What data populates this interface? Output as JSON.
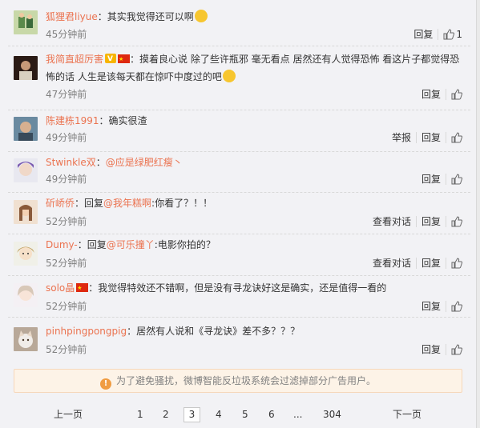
{
  "comments": [
    {
      "name": "狐狸君liyue",
      "text": "：其实我觉得还可以啊",
      "time": "45分钟前",
      "actions": [
        "回复"
      ],
      "likes": "1",
      "emoji": "laugh-cry"
    },
    {
      "name": "我简直超厉害",
      "text": "：摸着良心说 除了些许瓶邪 毫无看点 居然还有人觉得恐怖 看这片子都觉得恐",
      "text2": "怖的话 人生是该每天都在惊吓中度过的吧",
      "time": "47分钟前",
      "actions": [
        "回复"
      ],
      "emoji": "thinking"
    },
    {
      "name": "陈建栋1991",
      "text": "：确实很渣",
      "time": "49分钟前",
      "actions": [
        "举报",
        "回复"
      ]
    },
    {
      "name": "Stwinkle双",
      "text_pre": "：",
      "mention": "@应是绿肥红瘦丶",
      "text": "",
      "time": "49分钟前",
      "actions": [
        "回复"
      ]
    },
    {
      "name": "斫峤侨",
      "text_pre": "：回复",
      "mention": "@我年糕啊",
      "text": ":你看了？！！",
      "time": "52分钟前",
      "actions": [
        "查看对话",
        "回复"
      ]
    },
    {
      "name": "Dumy-",
      "text_pre": "：回复",
      "mention": "@可乐撞丫",
      "text": ":电影你拍的？",
      "time": "52分钟前",
      "actions": [
        "查看对话",
        "回复"
      ]
    },
    {
      "name": "solo晶",
      "text": "：我觉得特效还不错啊，但是没有寻龙诀好这是确实，还是值得一看的",
      "time": "52分钟前",
      "actions": [
        "回复"
      ]
    },
    {
      "name": "pinhpingpongpig",
      "text": "：居然有人说和《寻龙诀》差不多？？？",
      "time": "52分钟前",
      "actions": [
        "回复"
      ]
    }
  ],
  "notice": {
    "icon": "warning-icon",
    "text": "为了避免骚扰，微博智能反垃圾系统会过滤掉部分广告用户。"
  },
  "pagination": {
    "prev": "上一页",
    "pages": [
      "1",
      "2",
      "3",
      "4",
      "5",
      "6",
      "...",
      "304"
    ],
    "current": "3",
    "next": "下一页"
  },
  "colors": {
    "name": "#eb7350",
    "background": "#f2f2f5",
    "notice_bg": "#fdf3e7",
    "notice_border": "#f6d7ba"
  }
}
